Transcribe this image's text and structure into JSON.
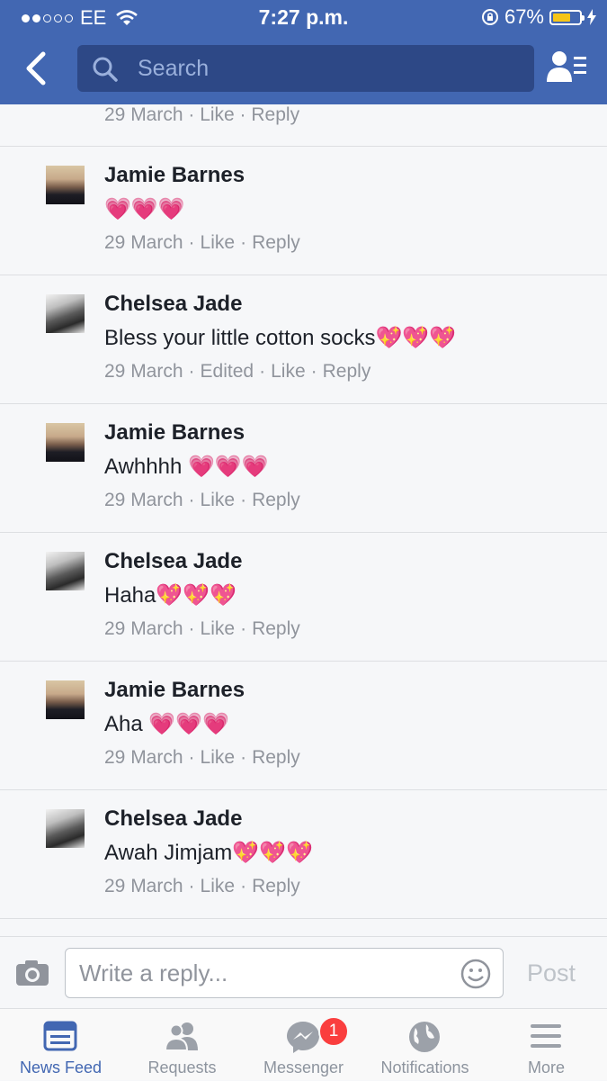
{
  "status_bar": {
    "carrier": "EE",
    "time": "7:27 p.m.",
    "battery": "67%",
    "battery_level": 0.67
  },
  "header": {
    "search_placeholder": "Search"
  },
  "thread": {
    "partial_meta": "29 March · Like · Reply",
    "comments": [
      {
        "name": "Jamie Barnes",
        "text": "💗💗💗",
        "date": "29 March",
        "edited": "",
        "like": "Like",
        "reply": "Reply"
      },
      {
        "name": "Chelsea Jade",
        "text": "Bless your little cotton socks💖💖💖",
        "date": "29 March",
        "edited": "Edited",
        "like": "Like",
        "reply": "Reply"
      },
      {
        "name": "Jamie Barnes",
        "text": "Awhhhh 💗💗💗",
        "date": "29 March",
        "edited": "",
        "like": "Like",
        "reply": "Reply"
      },
      {
        "name": "Chelsea Jade",
        "text": "Haha💖💖💖",
        "date": "29 March",
        "edited": "",
        "like": "Like",
        "reply": "Reply"
      },
      {
        "name": "Jamie Barnes",
        "text": "Aha 💗💗💗",
        "date": "29 March",
        "edited": "",
        "like": "Like",
        "reply": "Reply"
      },
      {
        "name": "Chelsea Jade",
        "text": "Awah Jimjam💖💖💖",
        "date": "29 March",
        "edited": "",
        "like": "Like",
        "reply": "Reply"
      }
    ]
  },
  "composer": {
    "placeholder": "Write a reply...",
    "post_label": "Post"
  },
  "tabbar": {
    "tabs": [
      {
        "label": "News Feed",
        "icon": "news-feed-icon"
      },
      {
        "label": "Requests",
        "icon": "friends-icon"
      },
      {
        "label": "Messenger",
        "icon": "messenger-icon"
      },
      {
        "label": "Notifications",
        "icon": "globe-icon"
      },
      {
        "label": "More",
        "icon": "menu-icon"
      }
    ],
    "messenger_badge": "1"
  },
  "colors": {
    "brand": "#4267b2",
    "badge": "#fa3e3e"
  }
}
